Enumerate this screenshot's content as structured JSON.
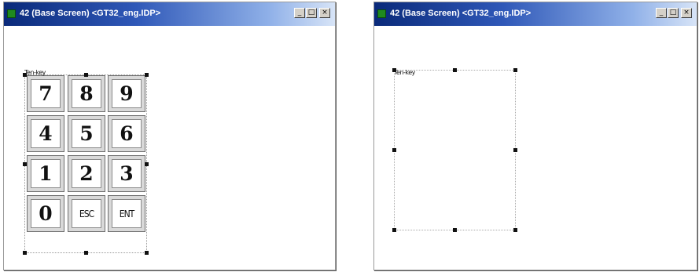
{
  "windows": [
    {
      "title": "42 (Base Screen) <GT32_eng.IDP>",
      "buttons": {
        "minimize": "_",
        "maximize": "□",
        "close": "×"
      },
      "object_label": "Ten-key",
      "keypad": {
        "keys": [
          "7",
          "8",
          "9",
          "4",
          "5",
          "6",
          "1",
          "2",
          "3",
          "0",
          "ESC",
          "ENT"
        ]
      }
    },
    {
      "title": "42 (Base Screen) <GT32_eng.IDP>",
      "buttons": {
        "minimize": "_",
        "maximize": "□",
        "close": "×"
      },
      "object_label": "Ten-key"
    }
  ],
  "colors": {
    "titlebar_dark": "#0a2a7a",
    "titlebar_light": "#d7e4f7",
    "title_icon": "#1f8a1f",
    "key_face": "#ffffff",
    "key_frame": "#d9d9d9"
  },
  "icons": {
    "title_icon": "screen-icon",
    "minimize": "minimize-icon",
    "maximize": "maximize-icon",
    "close": "close-icon"
  }
}
